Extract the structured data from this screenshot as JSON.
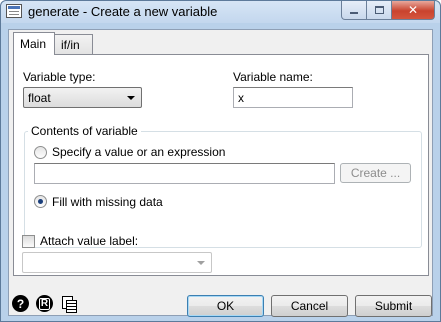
{
  "window": {
    "title": "generate - Create a new variable",
    "controls": {
      "minimize": "minimize",
      "maximize": "maximize",
      "close": "✕"
    }
  },
  "tabs": [
    {
      "label": "Main",
      "active": true
    },
    {
      "label": "if/in",
      "active": false
    }
  ],
  "main": {
    "variable_type_label": "Variable type:",
    "variable_type_value": "float",
    "variable_name_label": "Variable name:",
    "variable_name_value": "x",
    "contents_group_title": "Contents of variable",
    "radio_expression_label": "Specify a value or an expression",
    "expression_value": "",
    "create_button_label": "Create ...",
    "radio_missing_label": "Fill with missing data",
    "selected_option": "Fill with missing data",
    "attach_label_checkbox": "Attach value label:",
    "attach_label_checked": false,
    "value_label_selected": ""
  },
  "footer": {
    "icons": [
      "help-icon",
      "reset-icon",
      "copy-command-icon"
    ],
    "ok_label": "OK",
    "cancel_label": "Cancel",
    "submit_label": "Submit"
  },
  "colors": {
    "titlebar": "#c3d7ee",
    "window_frame": "#b9d1ea",
    "dialog_bg": "#f0f0f0",
    "default_button_border": "#3c7fb1"
  }
}
